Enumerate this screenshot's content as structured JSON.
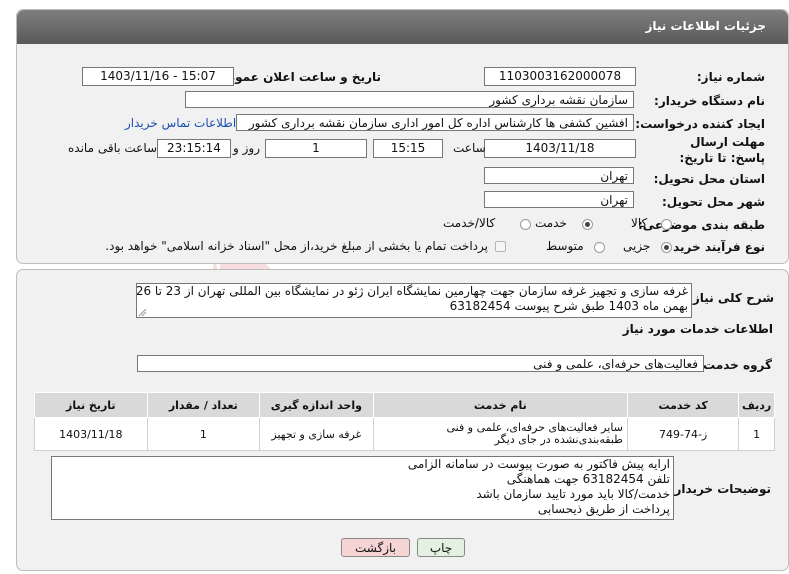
{
  "header": {
    "title": "جزئیات اطلاعات نیاز"
  },
  "fields": {
    "need_number_label": "شماره نیاز:",
    "need_number": "1103003162000078",
    "announce_label": "تاریخ و ساعت اعلان عمومی:",
    "announce_value": "1403/11/16 - 15:07",
    "buyer_org_label": "نام دستگاه خریدار:",
    "buyer_org": "سازمان نقشه برداری کشور",
    "creator_label": "ایجاد کننده درخواست:",
    "creator": "افشین کشفی ها کارشناس اداره کل امور اداری سازمان نقشه برداری کشور",
    "contact_link": "اطلاعات تماس خریدار",
    "deadline_label": "مهلت ارسال پاسخ: تا تاریخ:",
    "deadline_date": "1403/11/18",
    "time_label": "ساعت",
    "deadline_time": "15:15",
    "days_value": "1",
    "days_label": "روز و",
    "remaining_time": "23:15:14",
    "remaining_label": "ساعت باقی مانده",
    "province_label": "استان محل تحویل:",
    "province": "تهران",
    "city_label": "شهر محل تحویل:",
    "city": "تهران",
    "category_label": "طبقه بندی موضوعی:",
    "category_options": [
      "کالا",
      "خدمت",
      "کالا/خدمت"
    ],
    "process_label": "نوع فرآیند خرید :",
    "process_options": [
      "جزیی",
      "متوسط"
    ],
    "payment_note": "پرداخت تمام یا بخشی از مبلغ خرید،از محل \"اسناد خزانه اسلامی\" خواهد بود."
  },
  "summary": {
    "label": "شرح کلی نیاز:",
    "lines": [
      "غرفه سازی و تجهیز غرفه سازمان جهت چهارمین نمایشگاه ایران ژئو در نمایشگاه بین المللی تهران از 23 تا 26",
      "بهمن ماه 1403 طبق شرح پیوست 63182454"
    ]
  },
  "services": {
    "section_title": "اطلاعات خدمات مورد نیاز",
    "group_label": "گروه خدمت:",
    "group_value": "فعالیت‌های حرفه‌ای، علمی و فنی",
    "columns": [
      "ردیف",
      "کد خدمت",
      "نام خدمت",
      "واحد اندازه گیری",
      "تعداد / مقدار",
      "تاریخ نیاز"
    ],
    "rows": [
      {
        "row": "1",
        "code": "ز-74-749",
        "name": "سایر فعالیت‌های حرفه‌ای، علمی و فنی طبقه‌بندی‌نشده در جای دیگر",
        "unit": "غرفه سازی و تجهیز",
        "qty": "1",
        "date": "1403/11/18"
      }
    ]
  },
  "buyer_notes": {
    "label": "توضیحات خریدار:",
    "lines": [
      "ارایه پیش فاکتور به صورت پیوست در سامانه الزامی",
      "تلفن  63182454  جهت هماهنگی",
      "خدمت/کالا باید مورد تایید سازمان باشد",
      "پرداخت از طریق ذیحسابی"
    ]
  },
  "buttons": {
    "print": "چاپ",
    "back": "بازگشت"
  },
  "watermark": "AriaTender.neT",
  "colors": {
    "header_bg": "#6b6b6b",
    "link": "#1a4fb5",
    "back_btn": "#f7d4d4",
    "print_btn": "#e3f1e0"
  }
}
